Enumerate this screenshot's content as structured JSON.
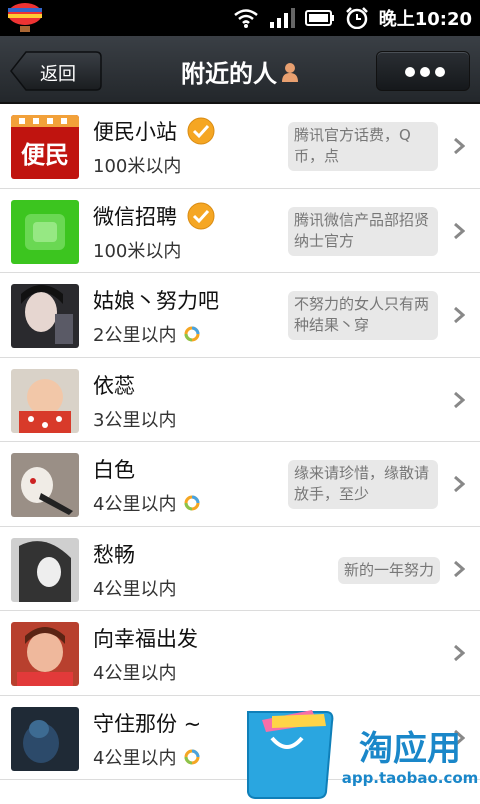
{
  "status_bar": {
    "time": "晚上10:20",
    "icons": [
      "balloon-app-icon",
      "wifi-icon",
      "signal-icon",
      "battery-icon",
      "alarm-clock-icon"
    ]
  },
  "header": {
    "back_label": "返回",
    "title": "附近的人",
    "title_icon": "person-icon",
    "more_icon": "more-dots-icon"
  },
  "people": [
    {
      "name": "便民小站",
      "distance": "100米以内",
      "signature": "腾讯官方话费，Q币，点",
      "verified": true,
      "album": false,
      "avatar": "bianmin-avatar"
    },
    {
      "name": "微信招聘",
      "distance": "100米以内",
      "signature": "腾讯微信产品部招贤纳士官方",
      "verified": true,
      "album": false,
      "avatar": "weixin-avatar"
    },
    {
      "name": "姑娘丶努力吧",
      "distance": "2公里以内",
      "signature": "不努力的女人只有两种结果丶穿",
      "verified": false,
      "album": true,
      "avatar": "photo-avatar"
    },
    {
      "name": "依蕊",
      "distance": "3公里以内",
      "signature": "",
      "verified": false,
      "album": false,
      "avatar": "baby-photo-avatar"
    },
    {
      "name": "白色",
      "distance": "4公里以内",
      "signature": "缘来请珍惜，缘散请放手，至少",
      "verified": false,
      "album": true,
      "avatar": "photo-avatar"
    },
    {
      "name": "愁畅",
      "distance": "4公里以内",
      "signature": "新的一年努力",
      "verified": false,
      "album": false,
      "avatar": "photo-avatar"
    },
    {
      "name": "向幸福出发",
      "distance": "4公里以内",
      "signature": "",
      "verified": false,
      "album": false,
      "avatar": "photo-avatar"
    },
    {
      "name": "守住那份 ~",
      "distance": "4公里以内",
      "signature": "",
      "verified": false,
      "album": true,
      "avatar": "photo-avatar"
    }
  ],
  "watermark": {
    "brand": "淘应用",
    "url": "app.taobao.com"
  },
  "colors": {
    "title_bar": "#2b2f34",
    "verified_badge": "#f5a623",
    "signature_bg": "#e8e8e8"
  }
}
